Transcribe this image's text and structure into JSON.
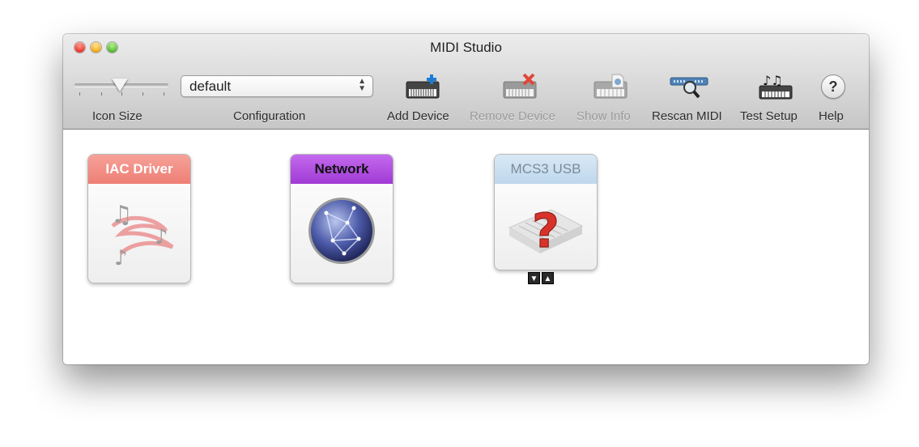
{
  "window": {
    "title": "MIDI Studio"
  },
  "toolbar": {
    "icon_size_label": "Icon Size",
    "configuration_label": "Configuration",
    "configuration_value": "default",
    "add_device_label": "Add Device",
    "remove_device_label": "Remove Device",
    "show_info_label": "Show Info",
    "rescan_midi_label": "Rescan MIDI",
    "test_setup_label": "Test Setup",
    "help_label": "Help",
    "help_glyph": "?"
  },
  "devices": [
    {
      "name": "IAC Driver",
      "icon": "music-notes-swirl-icon",
      "color": "#f08a80",
      "state": "offline"
    },
    {
      "name": "Network",
      "icon": "network-globe-icon",
      "color": "#a43ad8",
      "state": "online"
    },
    {
      "name": "MCS3 USB",
      "icon": "unknown-device-icon",
      "color": "#c9dff0",
      "state": "offline"
    }
  ],
  "port_arrows": {
    "down": "▼",
    "up": "▲"
  },
  "colors": {
    "remove_red": "#e0473a",
    "add_blue": "#1b7bd6",
    "question_red": "#d8332a"
  }
}
